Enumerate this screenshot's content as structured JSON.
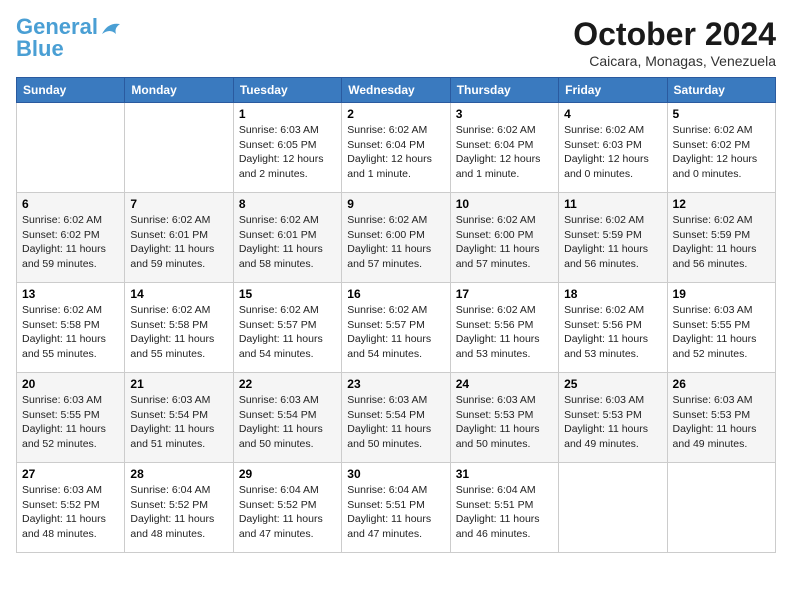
{
  "logo": {
    "line1": "General",
    "line2": "Blue"
  },
  "title": "October 2024",
  "subtitle": "Caicara, Monagas, Venezuela",
  "header_days": [
    "Sunday",
    "Monday",
    "Tuesday",
    "Wednesday",
    "Thursday",
    "Friday",
    "Saturday"
  ],
  "weeks": [
    [
      {
        "day": "",
        "info": ""
      },
      {
        "day": "",
        "info": ""
      },
      {
        "day": "1",
        "info": "Sunrise: 6:03 AM\nSunset: 6:05 PM\nDaylight: 12 hours\nand 2 minutes."
      },
      {
        "day": "2",
        "info": "Sunrise: 6:02 AM\nSunset: 6:04 PM\nDaylight: 12 hours\nand 1 minute."
      },
      {
        "day": "3",
        "info": "Sunrise: 6:02 AM\nSunset: 6:04 PM\nDaylight: 12 hours\nand 1 minute."
      },
      {
        "day": "4",
        "info": "Sunrise: 6:02 AM\nSunset: 6:03 PM\nDaylight: 12 hours\nand 0 minutes."
      },
      {
        "day": "5",
        "info": "Sunrise: 6:02 AM\nSunset: 6:02 PM\nDaylight: 12 hours\nand 0 minutes."
      }
    ],
    [
      {
        "day": "6",
        "info": "Sunrise: 6:02 AM\nSunset: 6:02 PM\nDaylight: 11 hours\nand 59 minutes."
      },
      {
        "day": "7",
        "info": "Sunrise: 6:02 AM\nSunset: 6:01 PM\nDaylight: 11 hours\nand 59 minutes."
      },
      {
        "day": "8",
        "info": "Sunrise: 6:02 AM\nSunset: 6:01 PM\nDaylight: 11 hours\nand 58 minutes."
      },
      {
        "day": "9",
        "info": "Sunrise: 6:02 AM\nSunset: 6:00 PM\nDaylight: 11 hours\nand 57 minutes."
      },
      {
        "day": "10",
        "info": "Sunrise: 6:02 AM\nSunset: 6:00 PM\nDaylight: 11 hours\nand 57 minutes."
      },
      {
        "day": "11",
        "info": "Sunrise: 6:02 AM\nSunset: 5:59 PM\nDaylight: 11 hours\nand 56 minutes."
      },
      {
        "day": "12",
        "info": "Sunrise: 6:02 AM\nSunset: 5:59 PM\nDaylight: 11 hours\nand 56 minutes."
      }
    ],
    [
      {
        "day": "13",
        "info": "Sunrise: 6:02 AM\nSunset: 5:58 PM\nDaylight: 11 hours\nand 55 minutes."
      },
      {
        "day": "14",
        "info": "Sunrise: 6:02 AM\nSunset: 5:58 PM\nDaylight: 11 hours\nand 55 minutes."
      },
      {
        "day": "15",
        "info": "Sunrise: 6:02 AM\nSunset: 5:57 PM\nDaylight: 11 hours\nand 54 minutes."
      },
      {
        "day": "16",
        "info": "Sunrise: 6:02 AM\nSunset: 5:57 PM\nDaylight: 11 hours\nand 54 minutes."
      },
      {
        "day": "17",
        "info": "Sunrise: 6:02 AM\nSunset: 5:56 PM\nDaylight: 11 hours\nand 53 minutes."
      },
      {
        "day": "18",
        "info": "Sunrise: 6:02 AM\nSunset: 5:56 PM\nDaylight: 11 hours\nand 53 minutes."
      },
      {
        "day": "19",
        "info": "Sunrise: 6:03 AM\nSunset: 5:55 PM\nDaylight: 11 hours\nand 52 minutes."
      }
    ],
    [
      {
        "day": "20",
        "info": "Sunrise: 6:03 AM\nSunset: 5:55 PM\nDaylight: 11 hours\nand 52 minutes."
      },
      {
        "day": "21",
        "info": "Sunrise: 6:03 AM\nSunset: 5:54 PM\nDaylight: 11 hours\nand 51 minutes."
      },
      {
        "day": "22",
        "info": "Sunrise: 6:03 AM\nSunset: 5:54 PM\nDaylight: 11 hours\nand 50 minutes."
      },
      {
        "day": "23",
        "info": "Sunrise: 6:03 AM\nSunset: 5:54 PM\nDaylight: 11 hours\nand 50 minutes."
      },
      {
        "day": "24",
        "info": "Sunrise: 6:03 AM\nSunset: 5:53 PM\nDaylight: 11 hours\nand 50 minutes."
      },
      {
        "day": "25",
        "info": "Sunrise: 6:03 AM\nSunset: 5:53 PM\nDaylight: 11 hours\nand 49 minutes."
      },
      {
        "day": "26",
        "info": "Sunrise: 6:03 AM\nSunset: 5:53 PM\nDaylight: 11 hours\nand 49 minutes."
      }
    ],
    [
      {
        "day": "27",
        "info": "Sunrise: 6:03 AM\nSunset: 5:52 PM\nDaylight: 11 hours\nand 48 minutes."
      },
      {
        "day": "28",
        "info": "Sunrise: 6:04 AM\nSunset: 5:52 PM\nDaylight: 11 hours\nand 48 minutes."
      },
      {
        "day": "29",
        "info": "Sunrise: 6:04 AM\nSunset: 5:52 PM\nDaylight: 11 hours\nand 47 minutes."
      },
      {
        "day": "30",
        "info": "Sunrise: 6:04 AM\nSunset: 5:51 PM\nDaylight: 11 hours\nand 47 minutes."
      },
      {
        "day": "31",
        "info": "Sunrise: 6:04 AM\nSunset: 5:51 PM\nDaylight: 11 hours\nand 46 minutes."
      },
      {
        "day": "",
        "info": ""
      },
      {
        "day": "",
        "info": ""
      }
    ]
  ]
}
